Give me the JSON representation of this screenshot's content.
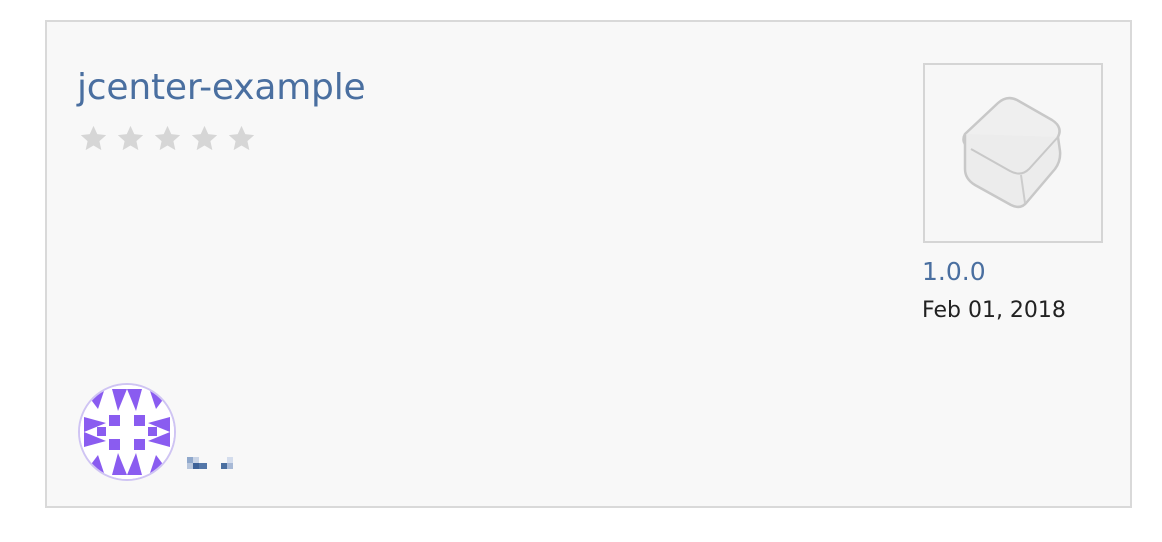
{
  "package": {
    "name": "jcenter-example",
    "rating": {
      "value": 0,
      "max": 5
    },
    "latest_version": "1.0.0",
    "updated_date": "Feb 01, 2018"
  },
  "icons": {
    "package_icon": "box-icon",
    "owner_avatar": "identicon-avatar",
    "rating": "star-icon"
  },
  "colors": {
    "link": "#4a6fa0",
    "star_empty": "#d6d6d6",
    "avatar_accent": "#8a5cf0",
    "card_bg": "#f8f8f8",
    "card_border": "#d9d9d9"
  }
}
